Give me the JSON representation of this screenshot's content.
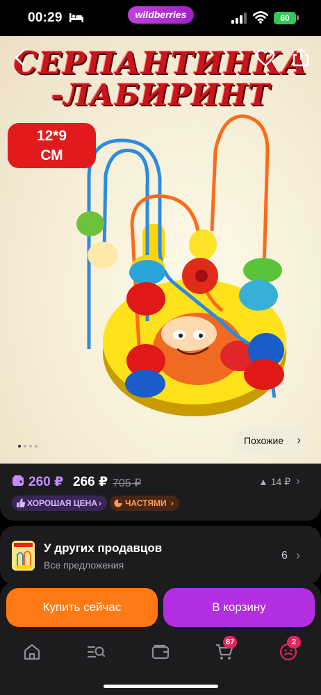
{
  "status_bar": {
    "time": "00:29",
    "app_pill": "wildberries",
    "battery": "60"
  },
  "product": {
    "title_line_1": "СЕРПАНТИНКА",
    "title_line_2": "-ЛАБИРИНТ",
    "size_badge_line_1": "12*9",
    "size_badge_line_2": "СМ",
    "similar_label": "Похожие",
    "gallery_dots": 4
  },
  "price": {
    "wallet_price": "260 ₽",
    "price": "266 ₽",
    "old_price": "705 ₽",
    "rating_label": "14 ₽"
  },
  "badges": {
    "good_price": "ХОРОШАЯ ЦЕНА",
    "installments": "ЧАСТЯМИ"
  },
  "other_sellers": {
    "title": "У других продавцов",
    "subtitle": "Все предложения",
    "count": "6"
  },
  "actions": {
    "buy_now": "Купить сейчас",
    "add_to_cart": "В корзину"
  },
  "tab_bar": {
    "cart_badge": "87",
    "profile_badge": "2"
  },
  "colors": {
    "wallet_price": "#c58bff",
    "buy_button": "#ff7a14",
    "cart_button": "#b32ee0",
    "badge": "#e6245e",
    "title_red": "#c8151b"
  }
}
